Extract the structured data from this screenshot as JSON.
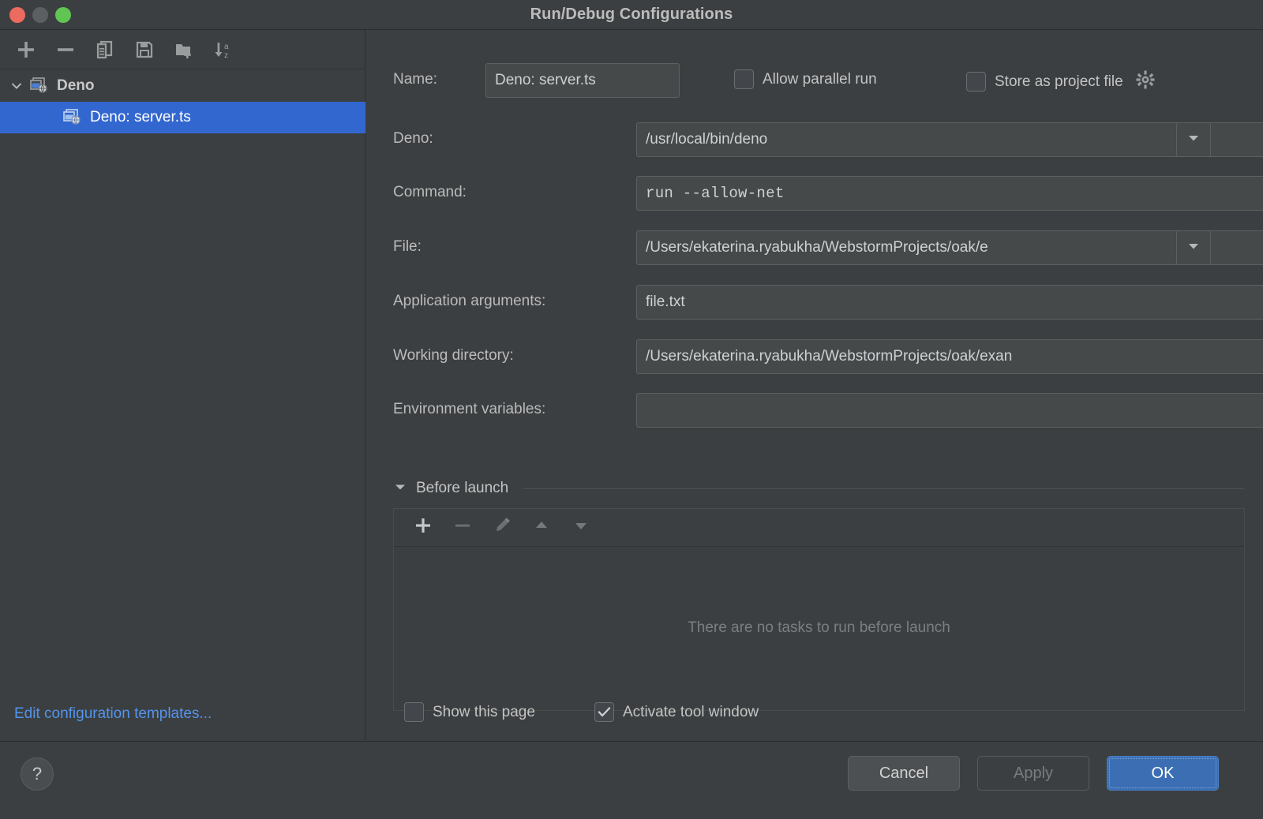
{
  "window": {
    "title": "Run/Debug Configurations",
    "traffic_lights": [
      "close",
      "minimize",
      "zoom"
    ]
  },
  "sidebar": {
    "toolbar": [
      {
        "name": "add",
        "icon": "plus-icon"
      },
      {
        "name": "remove",
        "icon": "minus-icon"
      },
      {
        "name": "copy",
        "icon": "copy-icon"
      },
      {
        "name": "save",
        "icon": "save-icon"
      },
      {
        "name": "move-into-folder",
        "icon": "folder-add-icon"
      },
      {
        "name": "sort-alphabetically",
        "icon": "sort-az-icon"
      }
    ],
    "tree": [
      {
        "label": "Deno",
        "type": "group",
        "expanded": true,
        "icon": "deno-config-icon"
      },
      {
        "label": "Deno: server.ts",
        "type": "item",
        "selected": true,
        "icon": "deno-config-icon"
      }
    ],
    "edit_templates_link": "Edit configuration templates..."
  },
  "form": {
    "name": {
      "label": "Name:",
      "value": "Deno: server.ts"
    },
    "allow_parallel_run": {
      "label": "Allow parallel run",
      "checked": false
    },
    "store_as_project_file": {
      "label": "Store as project file",
      "checked": false,
      "gear_icon": "gear-icon"
    },
    "deno": {
      "label": "Deno:",
      "value": "/usr/local/bin/deno",
      "browse_icon": "folder-icon",
      "dropdown_icon": "chevron-down-icon"
    },
    "command": {
      "label": "Command:",
      "value": "run --allow-net",
      "expand_icon": "expand-icon"
    },
    "file": {
      "label": "File:",
      "value": "/Users/ekaterina.ryabukha/WebstormProjects/oak/e",
      "browse_icon": "folder-icon",
      "dropdown_icon": "chevron-down-icon"
    },
    "application_arguments": {
      "label": "Application arguments:",
      "value": "file.txt",
      "add_icon": "plus-icon",
      "expand_icon": "expand-icon"
    },
    "working_directory": {
      "label": "Working directory:",
      "value": "/Users/ekaterina.ryabukha/WebstormProjects/oak/exan",
      "browse_icon": "folder-icon"
    },
    "environment_variables": {
      "label": "Environment variables:",
      "value": "",
      "editor_icon": "list-editor-icon"
    }
  },
  "before_launch": {
    "title": "Before launch",
    "expanded": true,
    "toolbar": [
      {
        "name": "add-task",
        "icon": "plus-icon",
        "enabled": true
      },
      {
        "name": "remove-task",
        "icon": "minus-icon",
        "enabled": false
      },
      {
        "name": "edit-task",
        "icon": "pencil-icon",
        "enabled": false
      },
      {
        "name": "move-task-up",
        "icon": "triangle-up-icon",
        "enabled": false
      },
      {
        "name": "move-task-down",
        "icon": "triangle-down-icon",
        "enabled": false
      }
    ],
    "empty_text": "There are no tasks to run before launch"
  },
  "options": {
    "show_this_page": {
      "label": "Show this page",
      "checked": false
    },
    "activate_tool_window": {
      "label": "Activate tool window",
      "checked": true
    }
  },
  "footer": {
    "help_label": "?",
    "cancel_label": "Cancel",
    "apply_label": "Apply",
    "apply_enabled": false,
    "ok_label": "OK"
  },
  "colors": {
    "background": "#3c3f41",
    "field_background": "#45494a",
    "selection_blue": "#3367d0",
    "link_blue": "#5394ec",
    "primary_button": "#3c6eb4",
    "text": "#bbbbbb",
    "muted_text": "#7a7f80"
  }
}
